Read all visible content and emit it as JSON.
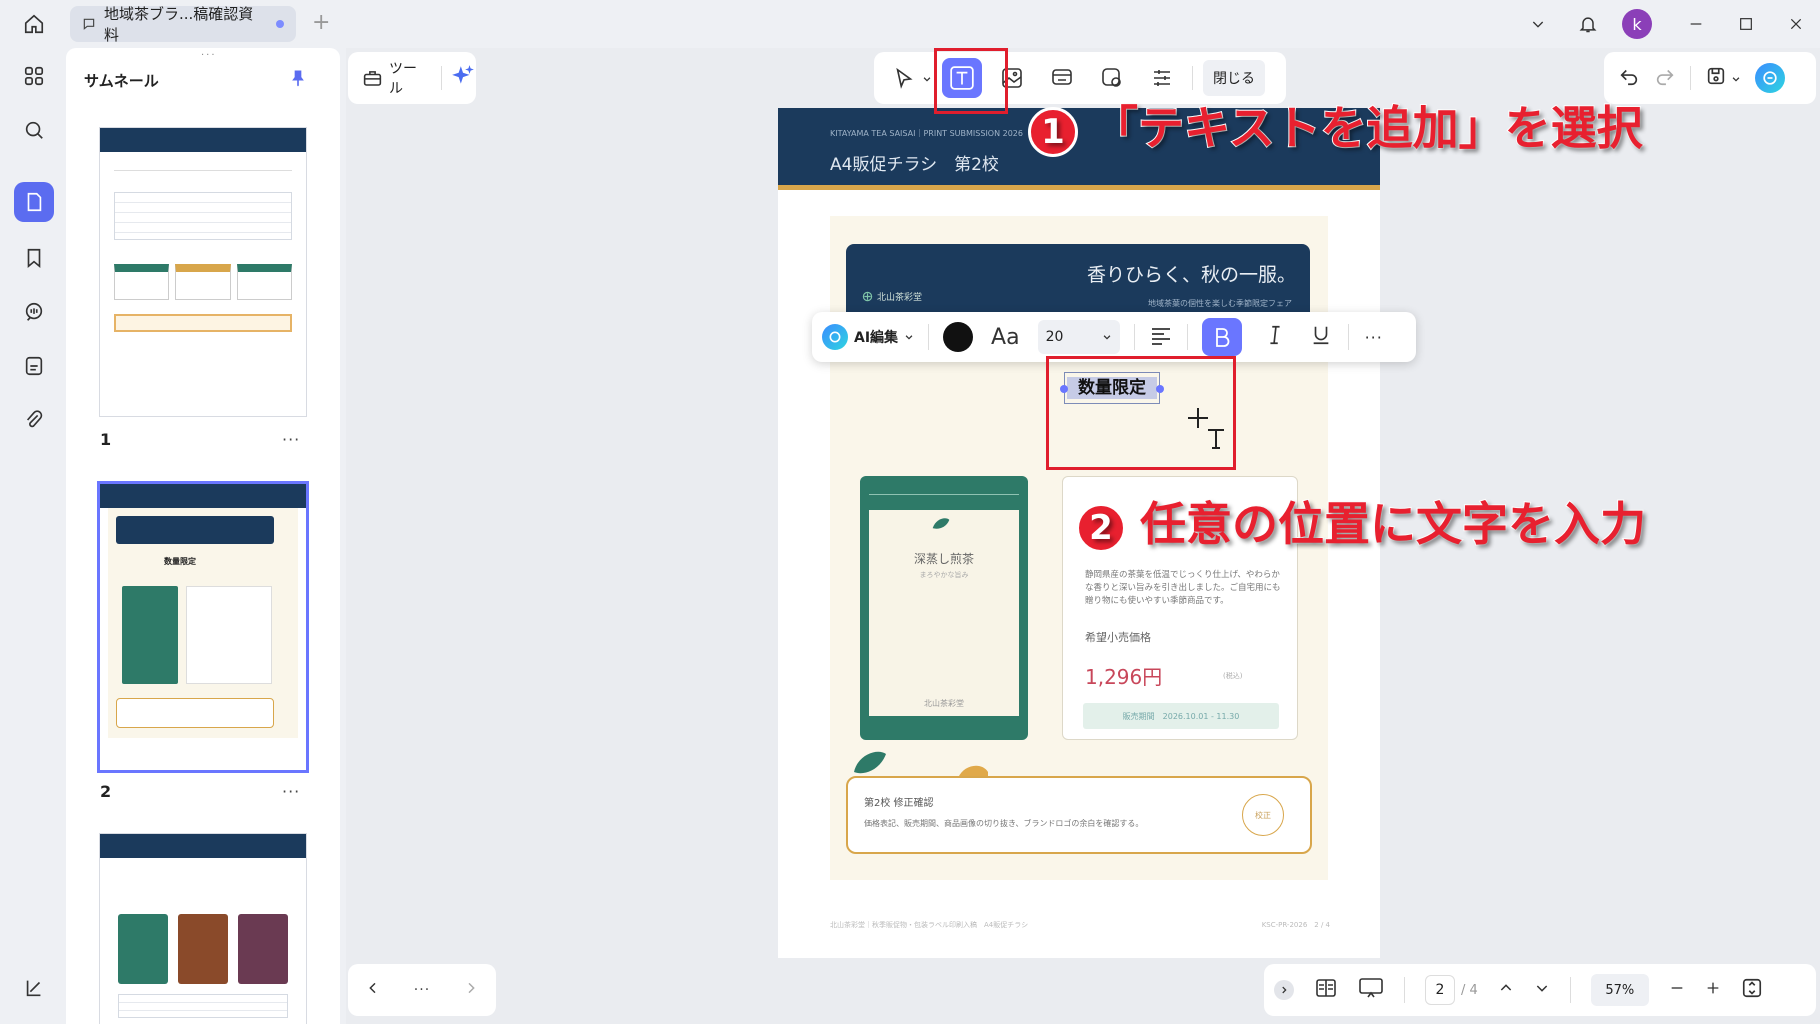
{
  "tab": {
    "title": "地域茶ブラ...稿確認資料"
  },
  "thumbnail_panel": {
    "title": "サムネール",
    "pages": [
      {
        "num": "1"
      },
      {
        "num": "2"
      }
    ],
    "more": "···"
  },
  "toolbar": {
    "tools_label": "ツール",
    "close_label": "閉じる"
  },
  "avatar": {
    "initial": "k"
  },
  "page": {
    "header_small": "KITAYAMA TEA SAISAI｜PRINT SUBMISSION 2026",
    "header_title": "A4販促チラシ　第2校",
    "banner_headline": "香りひらく、秋の一服。",
    "banner_brand": "北山茶彩堂",
    "banner_sub": "地域茶葉の個性を楽しむ季節限定フェア",
    "inserted_text": "数量限定",
    "product_name": "深蒸し煎茶",
    "product_sub": "まろやかな旨み",
    "product_brand": "北山茶彩堂",
    "description": "静岡県産の茶葉を低温でじっくり仕上げ、やわらかな香りと深い旨みを引き出しました。ご自宅用にも贈り物にも使いやすい季節商品です。",
    "price_label": "希望小売価格",
    "price": "1,296円",
    "tax": "(税込)",
    "sale_period": "販売期間　2026.10.01 - 11.30",
    "notice_title": "第2校 修正確認",
    "notice_body": "価格表記、販売期間、商品画像の切り抜き、ブランドロゴの余白を確認する。",
    "stamp": "校正",
    "footer_left": "北山茶彩堂｜秋季販促物・包装ラベル印刷入稿　A4販促チラシ",
    "footer_right": "KSC-PR-2026　2 / 4"
  },
  "format_bar": {
    "ai_label": "AI編集",
    "font_glyph": "Aa",
    "font_size": "20"
  },
  "callouts": {
    "step1_num": "1",
    "step1": "「テキストを追加」を選択",
    "step2_num": "2",
    "step2": "任意の位置に文字を入力"
  },
  "bottom_bar": {
    "current_page": "2",
    "total_pages": "/ 4",
    "zoom": "57%"
  },
  "colors": {
    "accent": "#6a76ff",
    "callout_red": "#e8202f",
    "navy": "#1b3a5c",
    "gold": "#d8a64b",
    "teal": "#2e7a68"
  }
}
